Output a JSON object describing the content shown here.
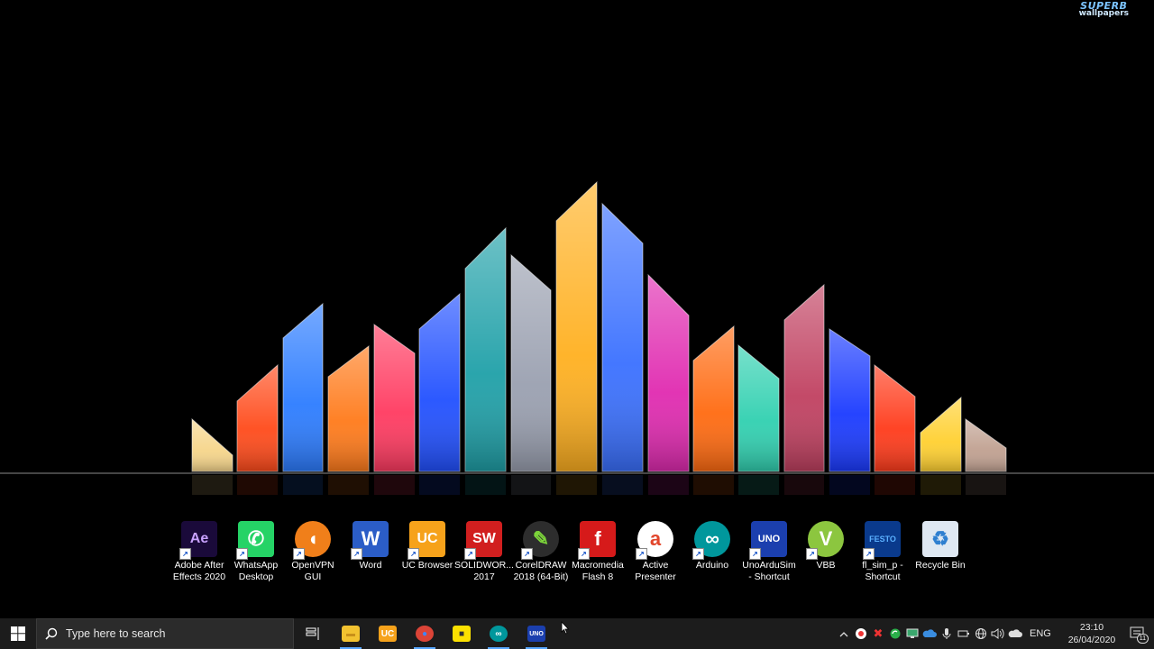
{
  "wallpaper": {
    "watermark_top": "SUPERB",
    "watermark_bottom": "wallpapers",
    "colors": [
      "#f6d58a",
      "#ff4a1a",
      "#2c7cff",
      "#ff7a1a",
      "#ff3a60",
      "#2150ff",
      "#1fa0a8",
      "#9aa0b0",
      "#ffb020",
      "#3a70ff",
      "#e02ab0",
      "#ff6a10",
      "#30d0b0",
      "#c04060",
      "#1a3aff",
      "#ff3a1a",
      "#ffd030",
      "#c0a090"
    ]
  },
  "desktop_icons": [
    {
      "label": "Adobe After\nEffects 2020",
      "icon": "after-effects-icon",
      "glyph": "Ae",
      "bg": "#1a0a3a",
      "fg": "#c9a2ff",
      "name": "adobe-after-effects"
    },
    {
      "label": "WhatsApp\nDesktop",
      "icon": "whatsapp-icon",
      "glyph": "✆",
      "bg": "#25d366",
      "fg": "#ffffff",
      "name": "whatsapp-desktop"
    },
    {
      "label": "OpenVPN\nGUI",
      "icon": "openvpn-icon",
      "glyph": "◖",
      "bg": "#f07f1a",
      "fg": "#ffffff",
      "name": "openvpn-gui"
    },
    {
      "label": "Word",
      "icon": "word-icon",
      "glyph": "W",
      "bg": "#2b5dc7",
      "fg": "#ffffff",
      "name": "word"
    },
    {
      "label": "UC Browser",
      "icon": "uc-browser-icon",
      "glyph": "UC",
      "bg": "#f6a21b",
      "fg": "#ffffff",
      "name": "uc-browser"
    },
    {
      "label": "SOLIDWOR...\n2017",
      "icon": "solidworks-icon",
      "glyph": "SW",
      "bg": "#d11f1f",
      "fg": "#ffffff",
      "name": "solidworks-2017"
    },
    {
      "label": "CorelDRAW\n2018 (64-Bit)",
      "icon": "coreldraw-icon",
      "glyph": "✎",
      "bg": "#2d2d2d",
      "fg": "#7dd63a",
      "name": "coreldraw-2018"
    },
    {
      "label": "Macromedia\nFlash 8",
      "icon": "flash-icon",
      "glyph": "f",
      "bg": "#d61a1a",
      "fg": "#ffffff",
      "name": "macromedia-flash-8"
    },
    {
      "label": "Active\nPresenter",
      "icon": "active-presenter-icon",
      "glyph": "a",
      "bg": "#ffffff",
      "fg": "#e2462c",
      "name": "active-presenter"
    },
    {
      "label": "Arduino",
      "icon": "arduino-icon",
      "glyph": "∞",
      "bg": "#00979c",
      "fg": "#ffffff",
      "name": "arduino"
    },
    {
      "label": "UnoArduSim\n- Shortcut",
      "icon": "unoardusim-icon",
      "glyph": "UNO",
      "bg": "#1b3fae",
      "fg": "#ffffff",
      "name": "unoardusim-shortcut"
    },
    {
      "label": "VBB",
      "icon": "vbb-icon",
      "glyph": "V",
      "bg": "#8cc63f",
      "fg": "#ffffff",
      "name": "vbb"
    },
    {
      "label": "fl_sim_p -\nShortcut",
      "icon": "festo-icon",
      "glyph": "FESTO",
      "bg": "#0a3a8c",
      "fg": "#5ab0ff",
      "name": "fl-sim-p-shortcut"
    },
    {
      "label": "Recycle Bin",
      "icon": "recycle-bin-icon",
      "glyph": "♻",
      "bg": "#dfe8f2",
      "fg": "#2f7fd0",
      "name": "recycle-bin"
    }
  ],
  "taskbar": {
    "search_placeholder": "Type here to search",
    "pinned": [
      {
        "name": "file-explorer",
        "icon": "folder-icon",
        "glyph": "▬",
        "bg": "#f2c230",
        "fg": "#c8901a",
        "running": true
      },
      {
        "name": "uc-browser",
        "icon": "uc-browser-icon",
        "glyph": "UC",
        "bg": "#f6a21b",
        "fg": "#ffffff",
        "running": false
      },
      {
        "name": "chrome",
        "icon": "chrome-icon",
        "glyph": "●",
        "bg": "#db4437",
        "fg": "#4285f4",
        "running": true
      },
      {
        "name": "sticky-notes",
        "icon": "sticky-notes-icon",
        "glyph": "■",
        "bg": "#fce100",
        "fg": "#333333",
        "running": false
      },
      {
        "name": "arduino",
        "icon": "arduino-icon",
        "glyph": "∞",
        "bg": "#00979c",
        "fg": "#ffffff",
        "running": true
      },
      {
        "name": "unoardusim",
        "icon": "unoardusim-icon",
        "glyph": "UNO",
        "bg": "#1b3fae",
        "fg": "#ffffff",
        "running": true
      }
    ],
    "language": "ENG",
    "time": "23:10",
    "date": "26/04/2020",
    "notification_count": "11"
  }
}
